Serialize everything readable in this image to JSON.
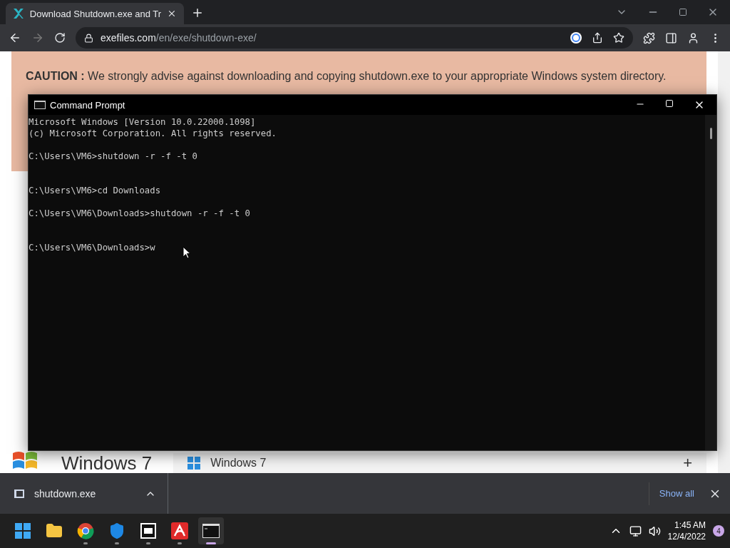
{
  "browser": {
    "tab": {
      "title": "Download Shutdown.exe and Tr",
      "selected": true
    },
    "url_host": "exefiles.com",
    "url_path": "/en/exe/shutdown-exe/"
  },
  "page": {
    "caution_label": "CAUTION :",
    "caution_text": "We strongly advise against downloading and copying shutdown.exe to your appropriate Windows system directory.",
    "logo_text": "Windows 7",
    "list_item": "Windows 7",
    "list_plus": "+"
  },
  "console": {
    "title": "Command Prompt",
    "blocks": [
      {
        "kind": "banner",
        "lines": [
          "Microsoft Windows [Version 10.0.22000.1098]",
          "(c) Microsoft Corporation. All rights reserved."
        ]
      },
      {
        "kind": "command_with_output",
        "lines": [
          "C:\\Users\\VM6>shutdown -r -f -t 0"
        ]
      },
      {
        "kind": "command",
        "lines": [
          "C:\\Users\\VM6>cd Downloads"
        ]
      },
      {
        "kind": "command_with_output",
        "lines": [
          "C:\\Users\\VM6\\Downloads>shutdown -r -f -t 0"
        ]
      },
      {
        "kind": "prompt",
        "lines": [
          "C:\\Users\\VM6\\Downloads>w"
        ]
      }
    ]
  },
  "downloads": {
    "file": "shutdown.exe",
    "show_all": "Show all"
  },
  "taskbar": {
    "apps": [
      {
        "kind": "start",
        "running": false,
        "selected": false
      },
      {
        "kind": "folder",
        "running": false,
        "selected": false
      },
      {
        "kind": "chrome",
        "running": true,
        "selected": false
      },
      {
        "kind": "shield",
        "running": true,
        "selected": false
      },
      {
        "kind": "zip",
        "running": true,
        "selected": false
      },
      {
        "kind": "avira",
        "running": true,
        "selected": false
      },
      {
        "kind": "console",
        "running": true,
        "selected": true
      }
    ],
    "time": "1:45 AM",
    "date": "12/4/2022",
    "badge": "4"
  }
}
